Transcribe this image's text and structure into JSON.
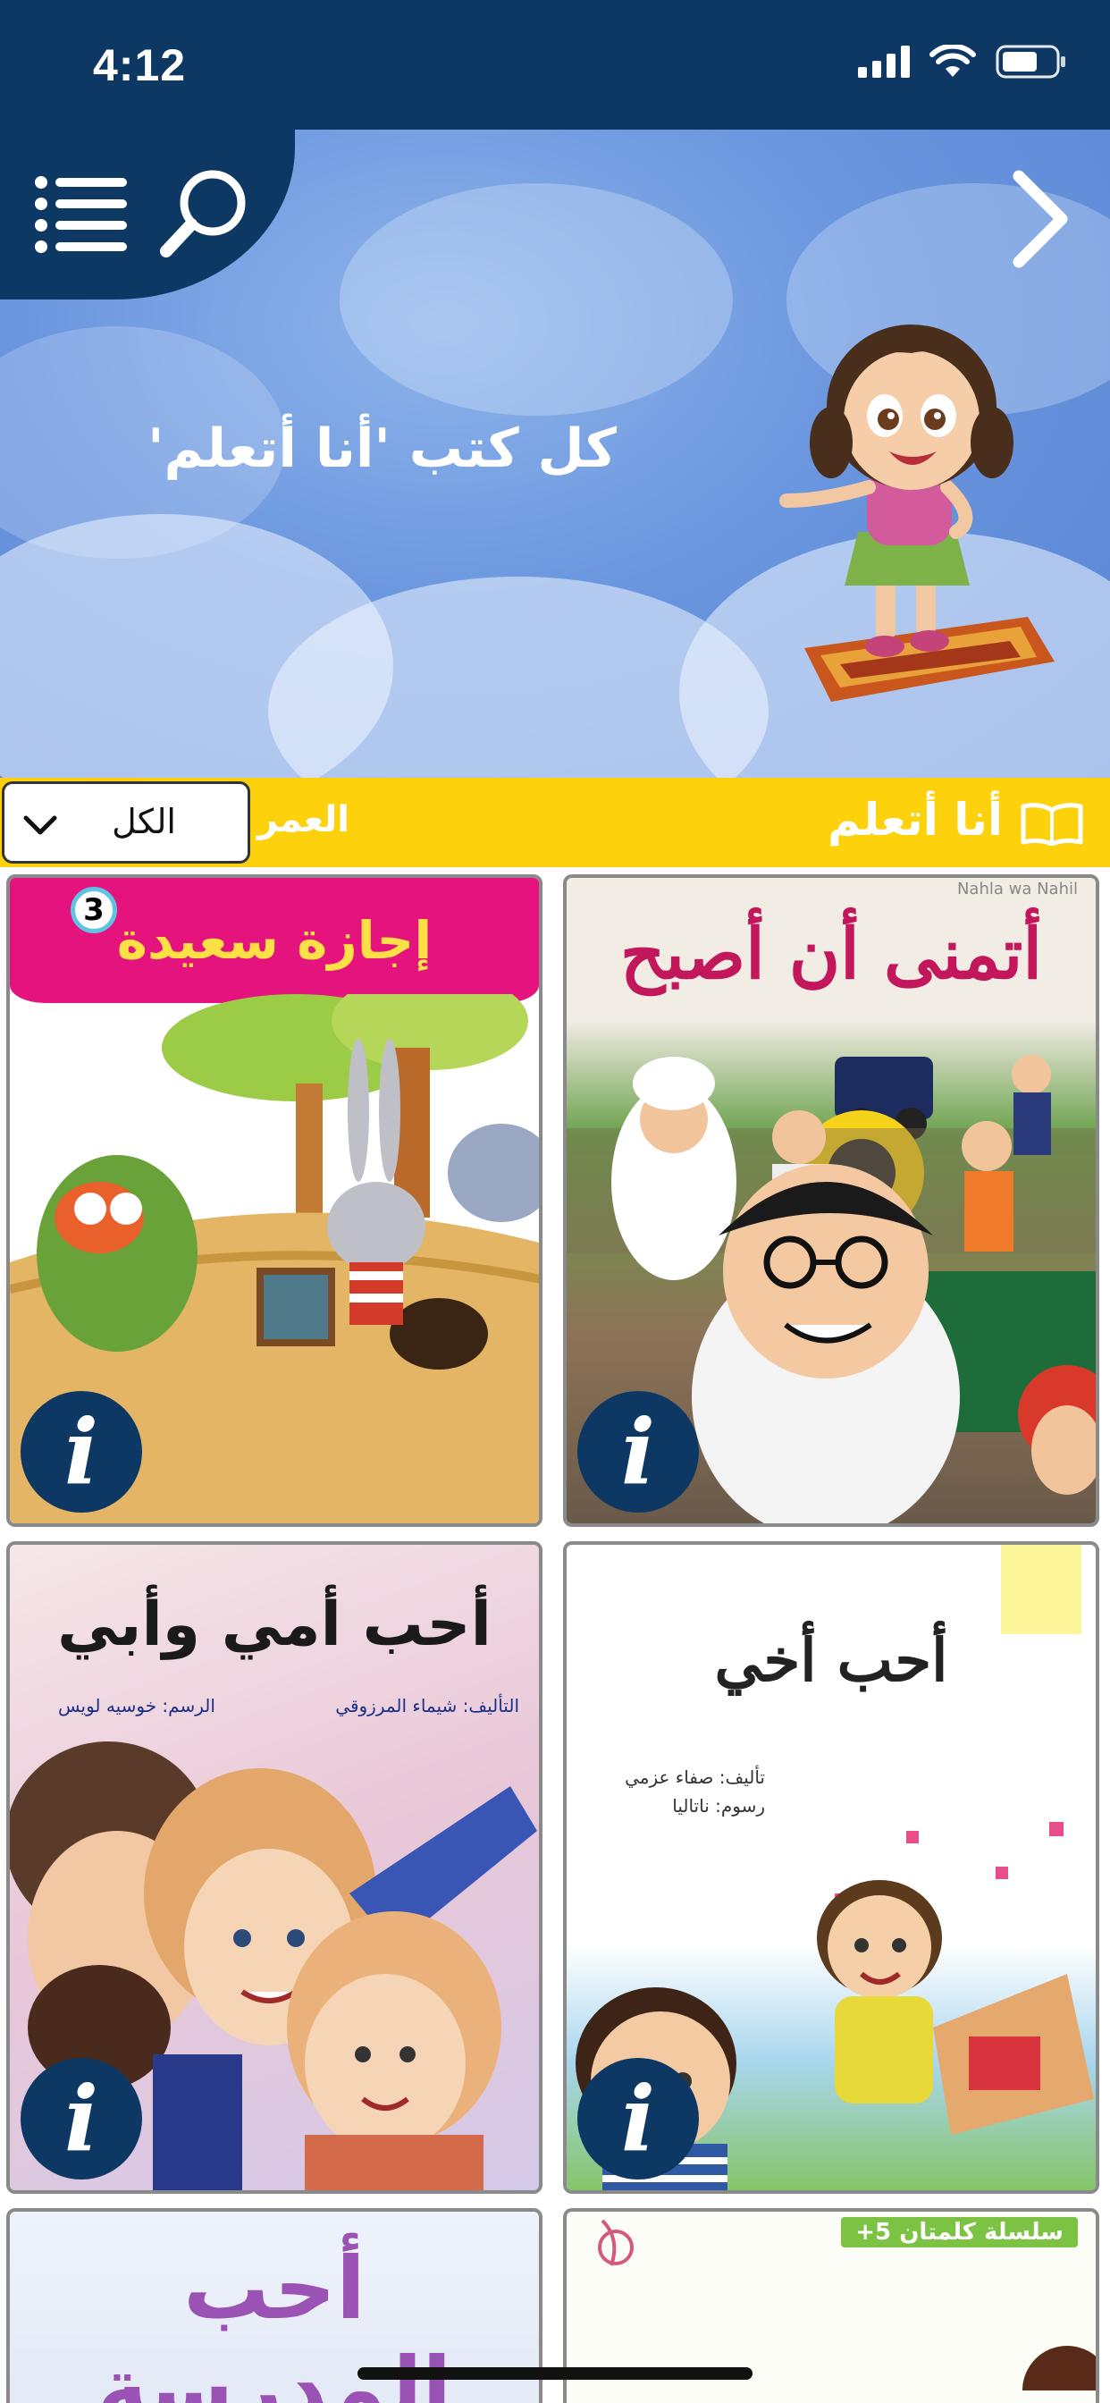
{
  "status_bar": {
    "time": "4:12"
  },
  "hero": {
    "title": "كل كتب 'أنا أتعلم'",
    "menu_icon": "list-icon",
    "search_icon": "magnifier-icon",
    "next_icon": "chevron-right-icon"
  },
  "filter_bar": {
    "category": "أنا أتعلم",
    "category_icon": "open-book-icon",
    "age_label": "العمر",
    "age_selected": "الكل"
  },
  "books": [
    {
      "title": "أتمنى أن أصبح",
      "publisher": "Nahla wa Nahil",
      "series_number": "",
      "info_icon": "info-icon"
    },
    {
      "title": "إجازة سعيدة",
      "series_number": "3",
      "info_icon": "info-icon"
    },
    {
      "title": "أحب أخي",
      "author": "تأليف: صفاء عزمي",
      "illustrator": "رسوم: ناتاليا",
      "info_icon": "info-icon"
    },
    {
      "title": "أحب أمي وأبي",
      "author": "التأليف: شيماء المرزوقي",
      "illustrator": "الرسم: خوسيه لويس",
      "info_icon": "info-icon"
    },
    {
      "title": "",
      "series": "سلسلة كلمتان 5+",
      "info_icon": "info-icon"
    },
    {
      "title": "أحب المدرسة",
      "info_icon": "info-icon"
    }
  ],
  "colors": {
    "navy": "#0e3864",
    "yellow": "#fdd20c",
    "sky": "#6a96df"
  }
}
